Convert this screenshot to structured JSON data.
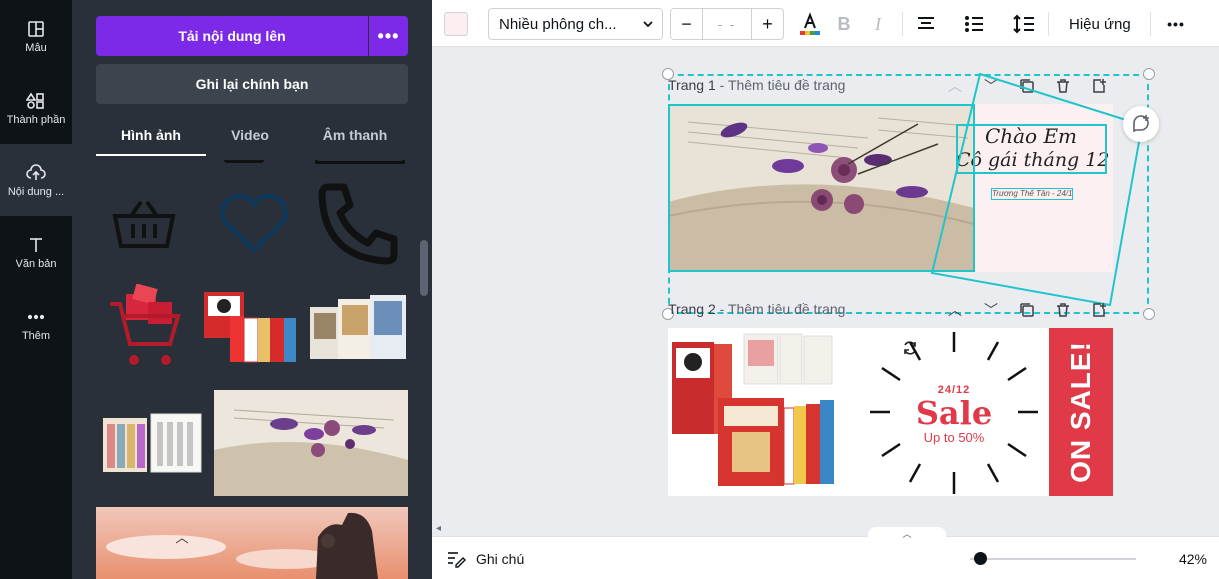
{
  "rail": {
    "items": [
      {
        "label": "Mẫu",
        "icon": "template-icon"
      },
      {
        "label": "Thành phần",
        "icon": "elements-icon"
      },
      {
        "label": "Nội dung ...",
        "icon": "upload-cloud-icon",
        "active": true
      },
      {
        "label": "Văn bản",
        "icon": "text-icon"
      },
      {
        "label": "Thêm",
        "icon": "more-dots-icon"
      }
    ]
  },
  "panel": {
    "upload_label": "Tải nội dung lên",
    "upload_more": "•••",
    "record_label": "Ghi lại chính bạn",
    "tabs": [
      {
        "label": "Hình ảnh",
        "active": true
      },
      {
        "label": "Video"
      },
      {
        "label": "Âm thanh"
      }
    ]
  },
  "toolbar": {
    "color_swatch": "#fdeef1",
    "font_name": "Nhiều phông ch...",
    "size_minus": "−",
    "size_value": "- -",
    "size_plus": "+",
    "effects_label": "Hiệu ứng",
    "more": "•••"
  },
  "pages": [
    {
      "prefix": "Trang 1",
      "title": "Thêm tiêu đề trang",
      "text_line1": "Chào Em",
      "text_line2": "Cô gái tháng 12",
      "small_text": "Trương Thế Tân - 24/12"
    },
    {
      "prefix": "Trang 2",
      "title": "Thêm tiêu đề trang",
      "sale_date": "24/12",
      "sale_title": "Sale",
      "sale_sub": "Up to 50%",
      "on_sale": "ON SALE!"
    }
  ],
  "footer": {
    "notes_label": "Ghi chú",
    "zoom": "42%"
  },
  "colors": {
    "accent": "#7d2ae8",
    "selection": "#20c4cb",
    "sale_red": "#e03a48"
  }
}
